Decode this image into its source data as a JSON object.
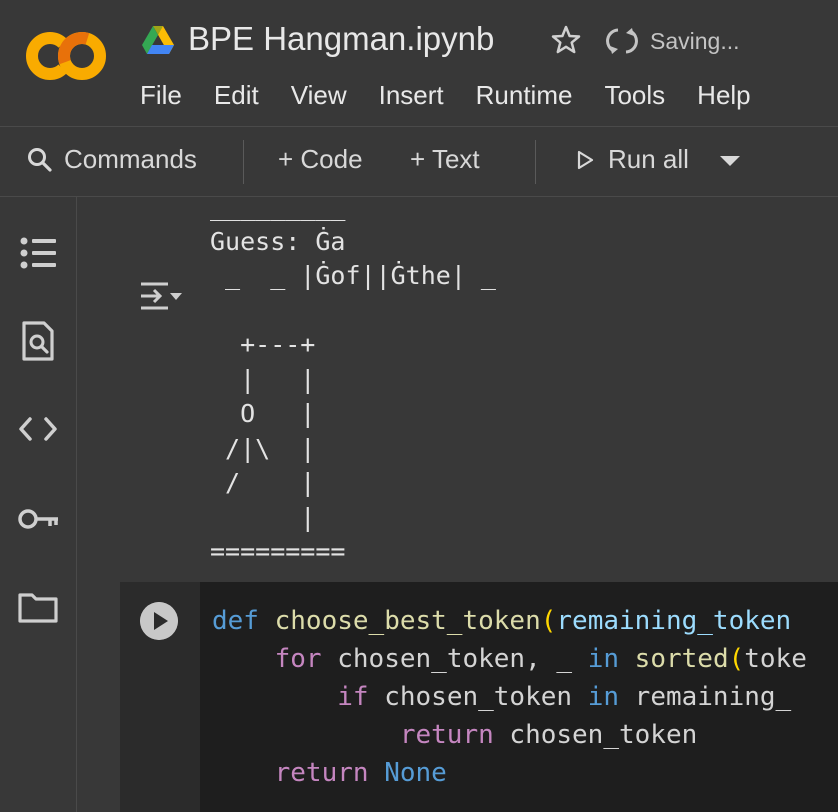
{
  "header": {
    "logo_text": "CO",
    "title": "BPE Hangman.ipynb",
    "status": "Saving...",
    "menu": [
      "File",
      "Edit",
      "View",
      "Insert",
      "Runtime",
      "Tools",
      "Help"
    ]
  },
  "toolbar": {
    "commands": "Commands",
    "add_code": "+ Code",
    "add_text": "+ Text",
    "run_all": "Run all"
  },
  "sidebar": {
    "icons": [
      "table-of-contents-icon",
      "find-icon",
      "code-snippets-icon",
      "secrets-key-icon",
      "files-folder-icon"
    ]
  },
  "output": {
    "text": "_________\nGuess: Ġa\n _  _ |Ġof||Ġthe| _\n\n  +---+\n  |   |\n  O   |\n /|\\  |\n /    |\n      |\n========="
  },
  "code_cell": {
    "lines": [
      [
        {
          "t": "def",
          "c": "kw"
        },
        {
          "t": " ",
          "c": "plain"
        },
        {
          "t": "choose_best_token",
          "c": "fn"
        },
        {
          "t": "(",
          "c": "paren"
        },
        {
          "t": "remaining_token",
          "c": "var"
        }
      ],
      [
        {
          "t": "    ",
          "c": "plain"
        },
        {
          "t": "for",
          "c": "kw2"
        },
        {
          "t": " chosen_token, _ ",
          "c": "plain"
        },
        {
          "t": "in",
          "c": "kw"
        },
        {
          "t": " ",
          "c": "plain"
        },
        {
          "t": "sorted",
          "c": "fn"
        },
        {
          "t": "(",
          "c": "paren"
        },
        {
          "t": "toke",
          "c": "plain"
        }
      ],
      [
        {
          "t": "        ",
          "c": "plain"
        },
        {
          "t": "if",
          "c": "kw2"
        },
        {
          "t": " chosen_token ",
          "c": "plain"
        },
        {
          "t": "in",
          "c": "kw"
        },
        {
          "t": " remaining_",
          "c": "plain"
        }
      ],
      [
        {
          "t": "            ",
          "c": "plain"
        },
        {
          "t": "return",
          "c": "kw2"
        },
        {
          "t": " chosen_token",
          "c": "plain"
        }
      ],
      [
        {
          "t": "    ",
          "c": "plain"
        },
        {
          "t": "return",
          "c": "kw2"
        },
        {
          "t": " ",
          "c": "plain"
        },
        {
          "t": "None",
          "c": "kw"
        }
      ]
    ]
  },
  "colors": {
    "background": "#383838",
    "code_bg": "#1e1e1e",
    "logo_orange": "#f9ab00",
    "logo_dark_orange": "#e8710a"
  }
}
